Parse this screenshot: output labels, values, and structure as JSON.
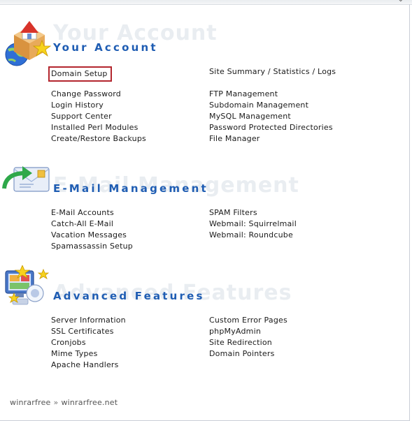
{
  "sections": [
    {
      "title": "Your Account",
      "icon": "home-box-star-icon",
      "left": [
        "Domain Setup",
        "",
        "Change Password",
        "Login History",
        "Support Center",
        "Installed Perl Modules",
        "Create/Restore Backups"
      ],
      "right": [
        "Site Summary / Statistics / Logs",
        "",
        "FTP Management",
        "Subdomain Management",
        "MySQL Management",
        "Password Protected Directories",
        "File Manager"
      ]
    },
    {
      "title": "E-Mail Management",
      "icon": "envelope-arrow-icon",
      "left": [
        "E-Mail Accounts",
        "Catch-All E-Mail",
        "Vacation Messages",
        "Spamassassin Setup"
      ],
      "right": [
        "SPAM Filters",
        "Webmail: Squirrelmail",
        "Webmail: Roundcube"
      ]
    },
    {
      "title": "Advanced Features",
      "icon": "monitor-stars-icon",
      "left": [
        "Server Information",
        "SSL Certificates",
        "Cronjobs",
        "Mime Types",
        "Apache Handlers"
      ],
      "right": [
        "Custom Error Pages",
        "phpMyAdmin",
        "Site Redirection",
        "Domain Pointers"
      ]
    }
  ],
  "footer": {
    "crumb1": "winrarfree",
    "separator": "»",
    "crumb2": "winrarfree.net"
  },
  "colors": {
    "title": "#1f5db3",
    "highlight": "#b3262e"
  }
}
